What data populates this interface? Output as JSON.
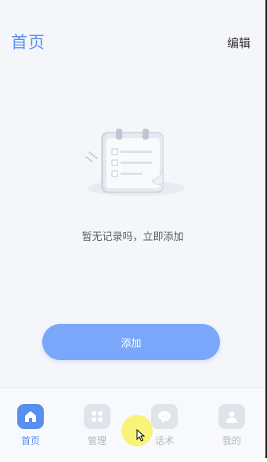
{
  "header": {
    "title": "首页",
    "edit_label": "编辑"
  },
  "empty_state": {
    "illustration": "checklist-calendar-illustration",
    "message": "暂无记录吗，立即添加"
  },
  "add_button": {
    "label": "添加"
  },
  "tabbar": {
    "active_color": "#5a8ff0",
    "items": [
      {
        "label": "首页",
        "icon": "home-icon",
        "active": true
      },
      {
        "label": "管理",
        "icon": "grid-icon",
        "active": false
      },
      {
        "label": "话术",
        "icon": "chat-icon",
        "active": false
      },
      {
        "label": "我的",
        "icon": "user-icon",
        "active": false
      }
    ]
  }
}
